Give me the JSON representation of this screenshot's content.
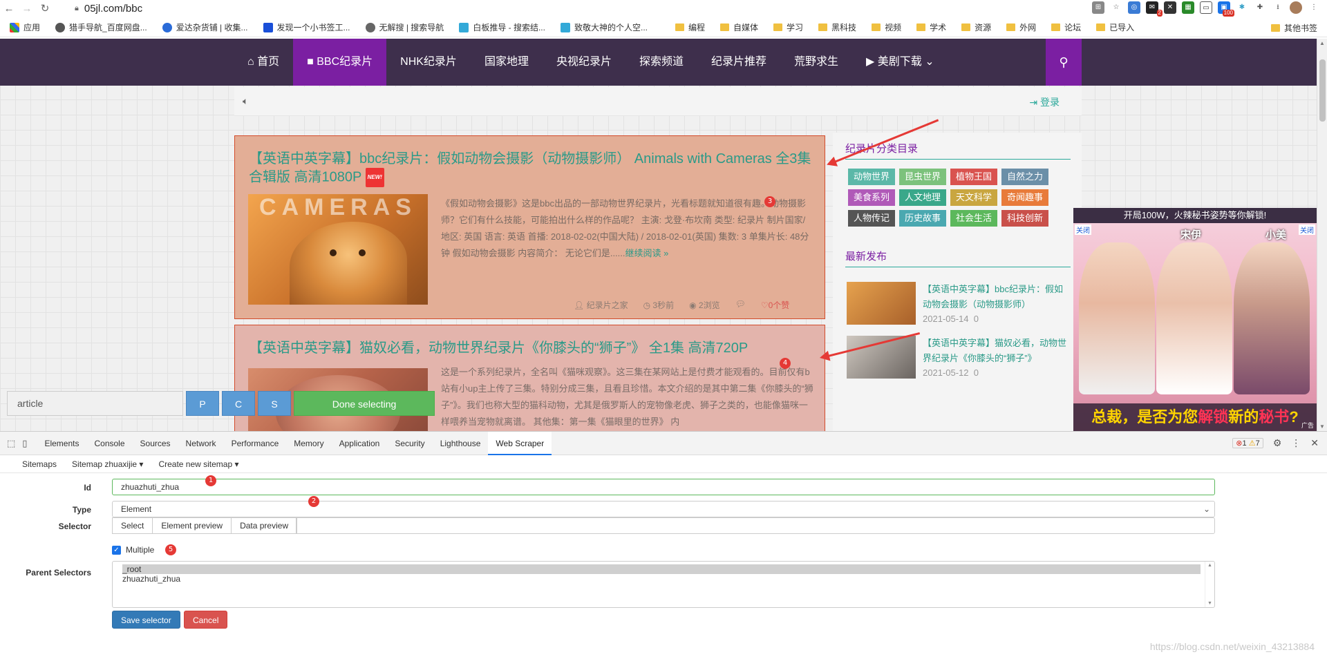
{
  "browser": {
    "url": "05jl.com/bbc",
    "bookmarks": [
      "应用",
      "猎手导航_百度网盘...",
      "爱达杂货铺 | 收集...",
      "发现一个小书签工...",
      "无解搜 | 搜索导航",
      "白板推导 - 搜索结...",
      "致敬大神的个人空...",
      "编程",
      "自媒体",
      "学习",
      "黑科技",
      "视频",
      "学术",
      "资源",
      "外网",
      "论坛",
      "已导入"
    ],
    "other_bookmarks": "其他书签",
    "ext_badges": {
      "gmail": "2",
      "counter": "100"
    }
  },
  "site": {
    "nav": [
      "首页",
      "BBC纪录片",
      "NHK纪录片",
      "国家地理",
      "央视纪录片",
      "探索频道",
      "纪录片推荐",
      "荒野求生",
      "美剧下载"
    ],
    "login": "登录",
    "articles": [
      {
        "title": "【英语中英字幕】bbc纪录片：假如动物会摄影（动物摄影师） Animals with Cameras 全3集合辑版 高清1080P",
        "badge": "NEW!",
        "thumb_text": "CAMERAS",
        "excerpt": "《假如动物会摄影》这是bbc出品的一部动物世界纪录片，光看标题就知道很有趣。动物摄影师？它们有什么技能，可能拍出什么样的作品呢？ 主演: 戈登·布坎南 类型: 纪录片 制片国家/地区: 英国 语言: 英语 首播: 2018-02-02(中国大陆) / 2018-02-01(英国) 集数: 3 单集片长: 48分钟 假如动物会摄影 内容简介：    无论它们是......",
        "readmore": "继续阅读 »",
        "author": "纪录片之家",
        "time": "3秒前",
        "views": "2浏览",
        "comments": "",
        "likes": "0个赞"
      },
      {
        "title": "【英语中英字幕】猫奴必看，动物世界纪录片《你膝头的“狮子”》 全1集 高清720P",
        "excerpt": "这是一个系列纪录片，全名叫《猫咪观察》。这三集在某网站上是付费才能观看的。目前仅有b站有小up主上传了三集。特别分成三集，且看且珍惜。本文介绍的是其中第二集《你膝头的“狮子”》。我们也称大型的猫科动物，尤其是俄罗斯人的宠物像老虎、狮子之类的，也能像猫咪一样喂养当宠物就离谱。 其他集：第一集《猫眼里的世界》 内"
      }
    ],
    "sidebar": {
      "cat_heading": "纪录片分类目录",
      "tags": [
        {
          "label": "动物世界",
          "color": "#5bb8a8"
        },
        {
          "label": "昆虫世界",
          "color": "#7cc27c"
        },
        {
          "label": "植物王国",
          "color": "#d9534f"
        },
        {
          "label": "自然之力",
          "color": "#6b8fa8"
        },
        {
          "label": "美食系列",
          "color": "#b05ab8"
        },
        {
          "label": "人文地理",
          "color": "#3aa88a"
        },
        {
          "label": "天文科学",
          "color": "#c9a640"
        },
        {
          "label": "奇闻趣事",
          "color": "#e87b3a"
        },
        {
          "label": "人物传记",
          "color": "#555555"
        },
        {
          "label": "历史故事",
          "color": "#4aa8b0"
        },
        {
          "label": "社会生活",
          "color": "#5cb85c"
        },
        {
          "label": "科技创新",
          "color": "#c9504a"
        }
      ],
      "recent_heading": "最新发布",
      "recent": [
        {
          "title": "【英语中英字幕】bbc纪录片：假如动物会摄影（动物摄影师）",
          "date": "2021-05-14",
          "count": "0"
        },
        {
          "title": "【英语中英字幕】猫奴必看，动物世界纪录片《你膝头的“狮子”》",
          "date": "2021-05-12",
          "count": "0"
        }
      ]
    },
    "ad": {
      "top": "开局100W，火辣秘书姿势等你解锁!",
      "close": "关闭",
      "names": [
        "宋伊",
        "小美"
      ],
      "bottom_a": "总裁，是否为您",
      "bottom_b": "解锁",
      "bottom_c": "新的",
      "bottom_d": "秘书",
      "bottom_e": "?",
      "ad_tag": "广告"
    }
  },
  "scraper_bar": {
    "input_value": "article",
    "buttons": [
      "P",
      "C",
      "S"
    ],
    "done": "Done selecting"
  },
  "annotations": {
    "n1": "1",
    "n2": "2",
    "n3": "3",
    "n4": "4",
    "n5": "5"
  },
  "devtools": {
    "tabs": [
      "Elements",
      "Console",
      "Sources",
      "Network",
      "Performance",
      "Memory",
      "Application",
      "Security",
      "Lighthouse",
      "Web Scraper"
    ],
    "active_tab": "Web Scraper",
    "errors": "1",
    "warnings": "7",
    "menu": [
      "Sitemaps",
      "Sitemap zhuaxijie ▾",
      "Create new sitemap ▾"
    ],
    "form": {
      "id_label": "Id",
      "id_value": "zhuazhuti_zhua",
      "type_label": "Type",
      "type_value": "Element",
      "selector_label": "Selector",
      "selector_buttons": [
        "Select",
        "Element preview",
        "Data preview"
      ],
      "multiple_label": "Multiple",
      "multiple_checked": true,
      "parent_label": "Parent Selectors",
      "parent_options": [
        "_root",
        "zhuazhuti_zhua"
      ],
      "save": "Save selector",
      "cancel": "Cancel"
    },
    "watermark": "https://blog.csdn.net/weixin_43213884"
  }
}
